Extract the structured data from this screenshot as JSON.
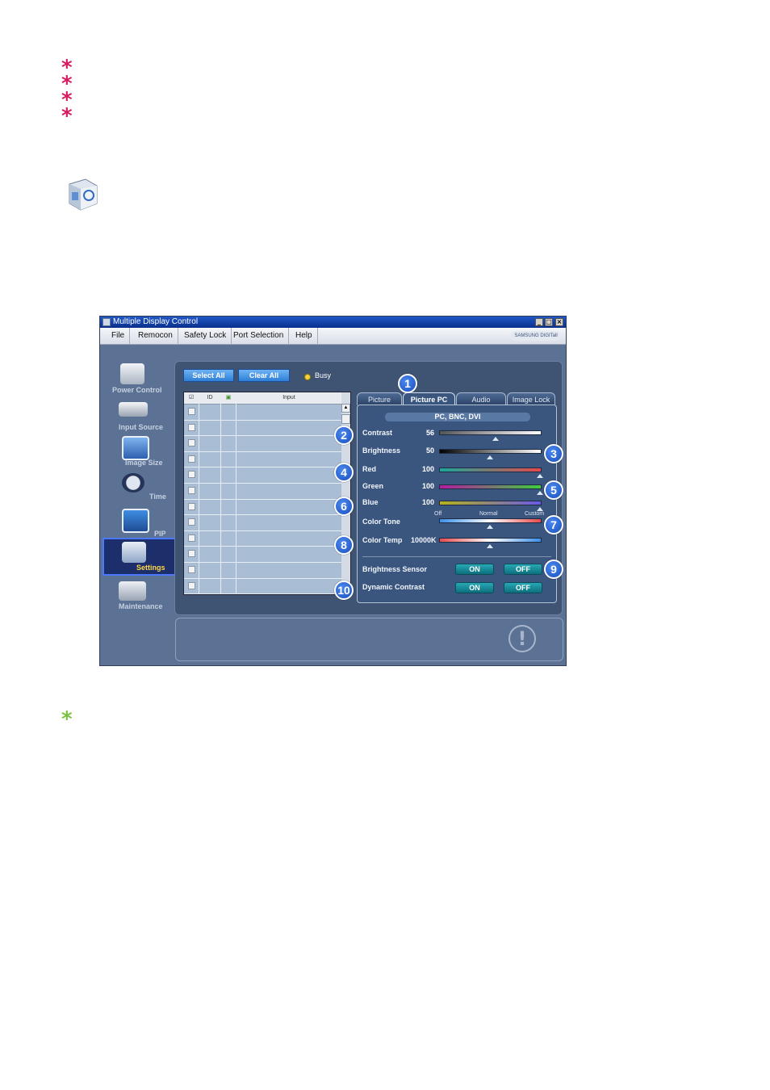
{
  "doc": {
    "asterisks": [
      "*",
      "*",
      "*",
      "*"
    ],
    "note_asterisk": "*"
  },
  "window": {
    "title": "Multiple Display Control",
    "controls": {
      "minimize": "_",
      "maximize": "□",
      "close": "×"
    },
    "menu": [
      "File",
      "Remocon",
      "Safety Lock",
      "Port Selection",
      "Help"
    ],
    "brand": "SAMSUNG DIGITall"
  },
  "nav": {
    "items": [
      {
        "label": "Power Control",
        "icon": "power-control-icon"
      },
      {
        "label": "Input Source",
        "icon": "input-source-icon"
      },
      {
        "label": "Image Size",
        "icon": "image-size-icon"
      },
      {
        "label": "Time",
        "icon": "clock-icon"
      },
      {
        "label": "PIP",
        "icon": "pip-icon"
      },
      {
        "label": "Settings",
        "icon": "settings-icon",
        "selected": true
      },
      {
        "label": "Maintenance",
        "icon": "maintenance-icon"
      }
    ]
  },
  "toolbar": {
    "select_all": "Select All",
    "clear_all": "Clear All",
    "busy": "Busy"
  },
  "grid": {
    "columns": {
      "check": "☑",
      "id": "ID",
      "status": "▣",
      "input": "Input"
    },
    "row_count": 12
  },
  "tabs": [
    "Picture",
    "Picture PC",
    "Audio",
    "Image Lock"
  ],
  "active_tab": "Picture PC",
  "panel": {
    "source": "PC, BNC, DVI",
    "sliders": [
      {
        "label": "Contrast",
        "value": "56",
        "level": 56
      },
      {
        "label": "Brightness",
        "value": "50",
        "level": 50
      },
      {
        "label": "Red",
        "value": "100",
        "level": 100
      },
      {
        "label": "Green",
        "value": "100",
        "level": 100
      },
      {
        "label": "Blue",
        "value": "100",
        "level": 100
      }
    ],
    "color_tone": {
      "label": "Color Tone",
      "ticks": [
        "Off",
        "Normal",
        "Custom"
      ],
      "selected": "Normal"
    },
    "color_temp": {
      "label": "Color Temp",
      "value": "10000K",
      "level": 50
    },
    "brightness_sensor": {
      "label": "Brightness Sensor",
      "on": "ON",
      "off": "OFF"
    },
    "dynamic_contrast": {
      "label": "Dynamic Contrast",
      "on": "ON",
      "off": "OFF"
    }
  },
  "callouts": [
    "1",
    "2",
    "3",
    "4",
    "5",
    "6",
    "7",
    "8",
    "9",
    "10"
  ],
  "colors": {
    "asterisk": "#d81b60",
    "note_asterisk": "#7cc242",
    "callout": "#1a4fbf",
    "window_bg": "#5b7294",
    "toggle": "#0d6f7d"
  }
}
